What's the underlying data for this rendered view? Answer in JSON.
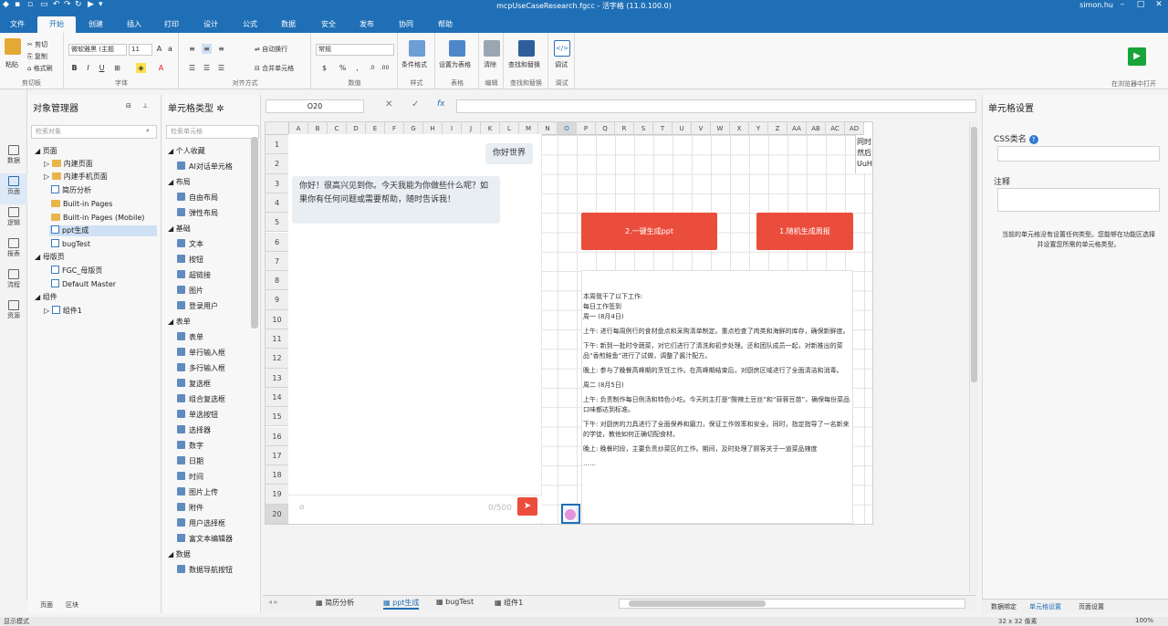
{
  "titlebar": {
    "title": "mcpUseCaseResearch.fgcc - 活字格 (11.0.100.0)",
    "user": "simon.hu"
  },
  "menu": [
    "文件",
    "开始",
    "创建",
    "插入",
    "打印",
    "设计",
    "公式",
    "数据",
    "安全",
    "发布",
    "协同",
    "帮助"
  ],
  "ribbon": {
    "paste": "粘贴",
    "cut": "剪切",
    "copy": "复制",
    "format_painter": "格式刷",
    "clipboard": "剪切板",
    "font_name": "微软雅黑 (主题",
    "font_size": "11",
    "font_group": "字体",
    "wrap_text": "自动换行",
    "merge": "合并单元格",
    "align_group": "对齐方式",
    "number_format": "常规",
    "number_group": "数值",
    "cond_format": "条件格式",
    "style_group": "样式",
    "set_table": "设置为表格",
    "table_group": "表格",
    "clear": "清除",
    "edit_group": "编辑",
    "find_replace": "查找和替换",
    "find_group": "查找和替换",
    "debug": "调试",
    "debug_group": "调试",
    "run_label": "在浏览器中打开"
  },
  "iconbar": [
    "数据",
    "页面",
    "逻辑",
    "报表",
    "流程",
    "资源"
  ],
  "objmgr": {
    "title": "对象管理器",
    "search_placeholder": "检索对象",
    "tree": [
      "页面",
      "内建页面",
      "内建手机页面",
      "简历分析",
      "Built-in Pages",
      "Built-in Pages (Mobile)",
      "ppt生成",
      "bugTest",
      "母版页",
      "FGC_母版页",
      "Default Master",
      "组件",
      "组件1"
    ],
    "bottom_tabs": [
      "页面",
      "区块"
    ]
  },
  "celltype": {
    "title": "单元格类型",
    "search_placeholder": "检索单元格",
    "sections": [
      {
        "name": "个人收藏",
        "items": [
          "AI对话单元格"
        ]
      },
      {
        "name": "布局",
        "items": [
          "自由布局",
          "弹性布局"
        ]
      },
      {
        "name": "基础",
        "items": [
          "文本",
          "按钮",
          "超链接",
          "图片",
          "登录用户"
        ]
      },
      {
        "name": "表单",
        "items": [
          "表单",
          "单行输入框",
          "多行输入框",
          "复选框",
          "组合复选框",
          "单选按钮",
          "选择器",
          "数字",
          "日期",
          "时间",
          "图片上传",
          "附件",
          "用户选择框",
          "富文本编辑器"
        ]
      },
      {
        "name": "数据",
        "items": [
          "数据导航按钮"
        ]
      }
    ]
  },
  "formula": {
    "cell_ref": "O20",
    "fx": "fx"
  },
  "grid": {
    "columns": [
      "A",
      "B",
      "C",
      "D",
      "E",
      "F",
      "G",
      "H",
      "I",
      "J",
      "K",
      "L",
      "M",
      "N",
      "O",
      "P",
      "Q",
      "R",
      "S",
      "T",
      "U",
      "V",
      "W",
      "X",
      "Y",
      "Z",
      "AA",
      "AB",
      "AC",
      "AD"
    ],
    "rows": [
      "1",
      "2",
      "3",
      "4",
      "5",
      "6",
      "7",
      "8",
      "9",
      "10",
      "11",
      "12",
      "13",
      "14",
      "15",
      "16",
      "17",
      "18",
      "19",
      "20"
    ],
    "active_col": "O",
    "active_row": "20",
    "col_ad_text": [
      "同时",
      "然后",
      "UuH"
    ]
  },
  "chat": {
    "user_message": "你好世界",
    "ai_message": "你好！很高兴见到你。今天我能为你做些什么呢？如果你有任何问题或需要帮助，随时告诉我！",
    "input_counter": "0/500"
  },
  "buttons": {
    "generate_ppt": "2.一键生成ppt",
    "random_report": "1.随机生成周报"
  },
  "report": {
    "lines": [
      "本周我干了以下工作:\n每日工作签到\n周一 (8月4日)",
      "上午: 进行每周例行的食材盘点和采购清单制定。重点检查了肉类和海鲜的库存，确保新鲜度。",
      "下午: 新到一批时令蔬菜，对它们进行了清洗和初步处理。还和团队成员一起，对新推出的菜品“香煎鲑鱼”进行了试做，调整了酱汁配方。",
      "晚上: 参与了晚餐高峰期的烹饪工作。在高峰期结束后，对厨房区域进行了全面清洁和消毒。",
      "周二 (8月5日)",
      "上午: 负责制作每日例汤和特色小吃。今天的主打是“酸辣土豆丝”和“蒜蓉豆苗”，确保每份菜品口味都达到标准。",
      "下午: 对厨房的刀具进行了全面保养和磨刀，保证工作效率和安全。同时，指定指导了一名新来的学徒，教他如何正确切配食材。",
      "晚上: 晚餐时段，主要负责炒菜区的工作。期间，及时处理了顾客关于一道菜品辣度",
      "……"
    ]
  },
  "rightpanel": {
    "title": "单元格设置",
    "css_label": "CSS类名",
    "note_label": "注释",
    "hint": "当前的单元格没有设置任何类型。您能够在功能区选择并设置您所需的单元格类型。",
    "bottom_tabs": [
      "数据绑定",
      "单元格设置",
      "页面设置"
    ]
  },
  "sheets": [
    "简历分析",
    "ppt生成",
    "bugTest",
    "组件1"
  ],
  "status": {
    "mode": "显示模式",
    "size": "32 x 32 像素",
    "zoom": "100%"
  },
  "colors": {
    "brand": "#1f6fb6",
    "accent_red": "#eb4d3d",
    "run_green": "#19a33b"
  }
}
